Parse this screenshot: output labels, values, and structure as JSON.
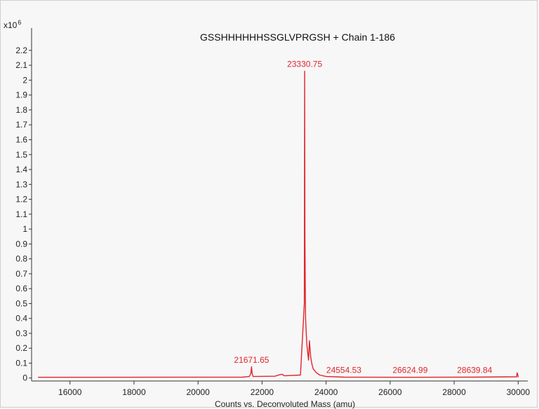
{
  "chart_data": {
    "type": "line",
    "title": "GSSHHHHHHSSGLVPRGSH + Chain 1-186",
    "xlabel": "Counts vs. Deconvoluted Mass (amu)",
    "ylabel": "",
    "y_multiplier_label": "x10",
    "y_multiplier_exp": "6",
    "xlim": [
      14800,
      30300
    ],
    "ylim": [
      -0.02,
      2.35
    ],
    "x_ticks": [
      16000,
      18000,
      20000,
      22000,
      24000,
      26000,
      28000,
      30000
    ],
    "x_tick_labels": [
      "16000",
      "18000",
      "20000",
      "22000",
      "24000",
      "26000",
      "28000",
      "30000"
    ],
    "y_ticks": [
      0,
      0.1,
      0.2,
      0.3,
      0.4,
      0.5,
      0.6,
      0.7,
      0.8,
      0.9,
      1,
      1.1,
      1.2,
      1.3,
      1.4,
      1.5,
      1.6,
      1.7,
      1.8,
      1.9,
      2,
      2.1,
      2.2
    ],
    "y_tick_labels": [
      "0",
      "0.1",
      "0.2",
      "0.3",
      "0.4",
      "0.5",
      "0.6",
      "0.7",
      "0.8",
      "0.9",
      "1",
      "1.1",
      "1.2",
      "1.3",
      "1.4",
      "1.5",
      "1.6",
      "1.7",
      "1.8",
      "1.9",
      "2",
      "2.1",
      "2.2"
    ],
    "series_color": "#e0262c",
    "grid": false,
    "series": [
      {
        "x": [
          15000,
          21400,
          21600,
          21650,
          21671.65,
          21690,
          21720,
          22400,
          22550,
          22620,
          22700,
          23200,
          23320,
          23330.75,
          23340,
          23350,
          23360,
          23380,
          23400,
          23420,
          23450,
          23480,
          23520,
          23560,
          23600,
          23700,
          23800,
          24000,
          24554.53,
          26624.99,
          28639.84,
          29950,
          29970,
          29990,
          30000
        ],
        "y": [
          0.005,
          0.006,
          0.01,
          0.03,
          0.075,
          0.03,
          0.01,
          0.012,
          0.022,
          0.025,
          0.015,
          0.02,
          0.5,
          2.06,
          0.95,
          0.6,
          0.4,
          0.3,
          0.22,
          0.18,
          0.12,
          0.25,
          0.14,
          0.09,
          0.06,
          0.035,
          0.02,
          0.01,
          0.006,
          0.005,
          0.006,
          0.008,
          0.035,
          0.02,
          0.005
        ]
      }
    ],
    "annotations": [
      {
        "x": 21671.65,
        "y": 0.075,
        "text": "21671.65"
      },
      {
        "x": 23330.75,
        "y": 2.06,
        "text": "23330.75"
      },
      {
        "x": 24554.53,
        "y": 0.006,
        "text": "24554.53"
      },
      {
        "x": 26624.99,
        "y": 0.005,
        "text": "26624.99"
      },
      {
        "x": 28639.84,
        "y": 0.006,
        "text": "28639.84"
      }
    ]
  }
}
